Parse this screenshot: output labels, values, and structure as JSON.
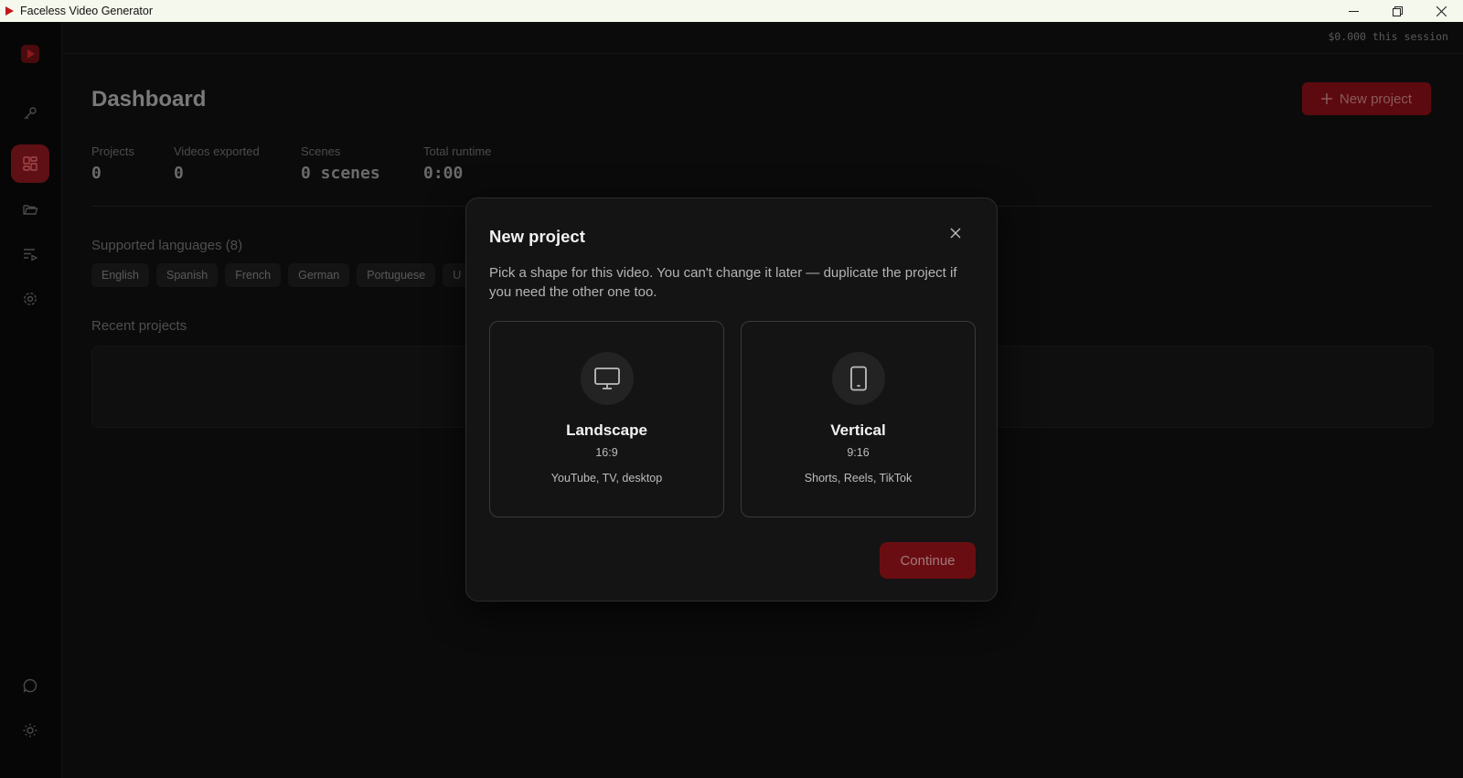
{
  "window": {
    "title": "Faceless Video Generator",
    "controls": [
      "minimize-icon",
      "restore-icon",
      "close-icon"
    ]
  },
  "sidebar": {
    "logo_icon": "play-logo-icon",
    "items": [
      {
        "name": "api-keys",
        "icon": "key-icon",
        "active": false
      },
      {
        "name": "dashboard",
        "icon": "grid-icon",
        "active": true
      },
      {
        "name": "projects",
        "icon": "folder-icon",
        "active": false
      },
      {
        "name": "queue",
        "icon": "playlist-icon",
        "active": false
      },
      {
        "name": "settings",
        "icon": "gear-icon",
        "active": false
      }
    ],
    "bottom_items": [
      {
        "name": "feedback",
        "icon": "chat-bubble-icon"
      },
      {
        "name": "theme",
        "icon": "sun-icon"
      }
    ]
  },
  "header": {
    "session_cost": "$0.000 this session"
  },
  "dashboard": {
    "title": "Dashboard",
    "new_project_label": "New project",
    "stats": [
      {
        "label": "Projects",
        "value": "0"
      },
      {
        "label": "Videos exported",
        "value": "0"
      },
      {
        "label": "Scenes",
        "value": "0 scenes"
      },
      {
        "label": "Total runtime",
        "value": "0:00"
      }
    ],
    "languages_title": "Supported languages (8)",
    "languages": [
      "English",
      "Spanish",
      "French",
      "German",
      "Portuguese",
      "U"
    ],
    "recent_title": "Recent projects"
  },
  "modal": {
    "title": "New project",
    "description": "Pick a shape for this video. You can't change it later — duplicate the project if you need the other one too.",
    "options": [
      {
        "title": "Landscape",
        "ratio": "16:9",
        "uses": "YouTube, TV, desktop",
        "icon": "monitor-icon"
      },
      {
        "title": "Vertical",
        "ratio": "9:16",
        "uses": "Shorts, Reels, TikTok",
        "icon": "phone-icon"
      }
    ],
    "continue_label": "Continue"
  },
  "colors": {
    "accent": "#5e1014",
    "background": "#0b0b0b",
    "modal_bg": "#141414"
  }
}
